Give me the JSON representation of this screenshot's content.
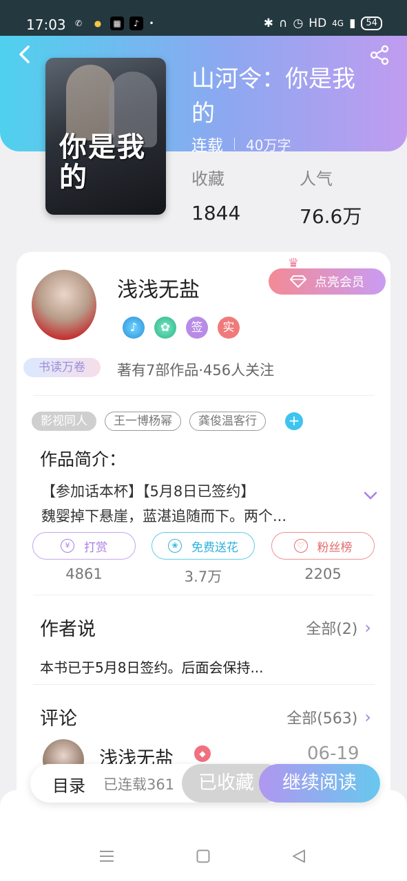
{
  "status_bar": {
    "time": "17:03",
    "network": "HD",
    "signal": "4G",
    "battery": "54"
  },
  "book": {
    "title": "山河令：你是我的",
    "status": "连载",
    "word_count": "40万字",
    "cover_text": "你是我的",
    "stats": [
      {
        "label": "收藏",
        "value": "1844"
      },
      {
        "label": "人气",
        "value": "76.6万"
      }
    ]
  },
  "author": {
    "name": "浅浅无盐",
    "vip_label": "点亮会员",
    "level_badge": "书读万卷",
    "info": "著有7部作品·456人关注",
    "badges": [
      "签",
      "实"
    ]
  },
  "tags": [
    "影视同人",
    "王一博杨幂",
    "龚俊温客行"
  ],
  "intro": {
    "title": "作品简介：",
    "line1": "【参加话本杯】【5月8日已签约】",
    "line2": "魏婴掉下悬崖，蓝湛追随而下。两个..."
  },
  "actions": [
    {
      "label": "打赏",
      "count": "4861"
    },
    {
      "label": "免费送花",
      "count": "3.7万"
    },
    {
      "label": "粉丝榜",
      "count": "2205"
    }
  ],
  "author_say": {
    "title": "作者说",
    "more": "全部(2)",
    "content": "本书已于5月8日签约。后面会保持..."
  },
  "comments": {
    "title": "评论",
    "more": "全部(563)",
    "first": {
      "user": "浅浅无盐",
      "date": "06-19"
    }
  },
  "bottom_bar": {
    "catalog": "目录",
    "serial": "已连载361",
    "collected": "已收藏",
    "read": "继续阅读"
  },
  "colors": {
    "accent_purple": "#a97de6",
    "accent_blue": "#3ec4ef",
    "gradient_start": "#4fd1ee",
    "gradient_end": "#c09cf0"
  }
}
